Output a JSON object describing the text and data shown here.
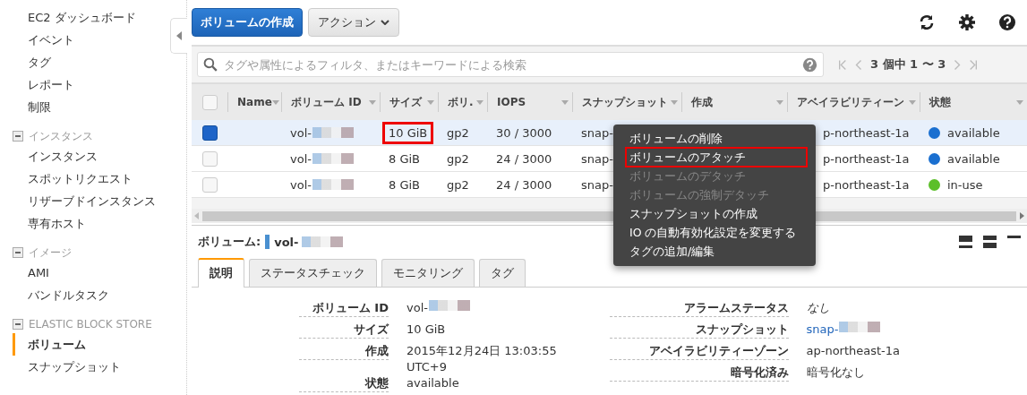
{
  "sidebar": {
    "items": [
      {
        "label": "EC2 ダッシュボード",
        "selected": false
      },
      {
        "label": "イベント",
        "selected": false
      },
      {
        "label": "タグ",
        "selected": false
      },
      {
        "label": "レポート",
        "selected": false
      },
      {
        "label": "制限",
        "selected": false
      }
    ],
    "sections": [
      {
        "title": "インスタンス",
        "expanded": true,
        "items": [
          {
            "label": "インスタンス",
            "selected": false
          },
          {
            "label": "スポットリクエスト",
            "selected": false
          },
          {
            "label": "リザーブドインスタンス",
            "selected": false
          },
          {
            "label": "専有ホスト",
            "selected": false
          }
        ]
      },
      {
        "title": "イメージ",
        "expanded": true,
        "items": [
          {
            "label": "AMI",
            "selected": false
          },
          {
            "label": "バンドルタスク",
            "selected": false
          }
        ]
      },
      {
        "title": "ELASTIC BLOCK STORE",
        "expanded": true,
        "items": [
          {
            "label": "ボリューム",
            "selected": true
          },
          {
            "label": "スナップショット",
            "selected": false
          }
        ]
      }
    ]
  },
  "toolbar": {
    "create_button": "ボリュームの作成",
    "actions_button": "アクション"
  },
  "search": {
    "placeholder": "タグや属性によるフィルタ、またはキーワードによる検索"
  },
  "pagination": {
    "label": "3 個中 1 〜 3"
  },
  "table": {
    "select_all": {
      "checked": false
    },
    "columns": [
      "Name",
      "ボリューム ID",
      "サイズ",
      "ボリ.",
      "IOPS",
      "スナップショット",
      "作成",
      "アベイラビリティーン",
      "状態"
    ],
    "rows": [
      {
        "selected": true,
        "volume_id": "vol-",
        "size": "10 GiB",
        "size_highlighted": true,
        "type": "gp2",
        "iops": "30 / 3000",
        "snapshot": "snap-",
        "zone": "p-northeast-1a",
        "state": "available",
        "color": "#1a6fd0"
      },
      {
        "selected": false,
        "volume_id": "vol-",
        "size": "8 GiB",
        "size_highlighted": false,
        "type": "gp2",
        "iops": "24 / 3000",
        "snapshot": "snap-",
        "zone": "p-northeast-1a",
        "state": "available",
        "color": "#1a6fd0"
      },
      {
        "selected": false,
        "volume_id": "vol-",
        "size": "8 GiB",
        "size_highlighted": false,
        "type": "gp2",
        "iops": "24 / 3000",
        "snapshot": "snap-",
        "zone": "p-northeast-1a",
        "state": "in-use",
        "color": "#5cbf2a"
      }
    ]
  },
  "context_menu": {
    "items": [
      {
        "label": "ボリュームの削除",
        "disabled": false,
        "highlighted": false
      },
      {
        "label": "ボリュームのアタッチ",
        "disabled": false,
        "highlighted": true
      },
      {
        "label": "ボリュームのデタッチ",
        "disabled": true,
        "highlighted": false
      },
      {
        "label": "ボリュームの強制デタッチ",
        "disabled": true,
        "highlighted": false
      },
      {
        "label": "スナップショットの作成",
        "disabled": false,
        "highlighted": false
      },
      {
        "label": "IO の自動有効化設定を変更する",
        "disabled": false,
        "highlighted": false
      },
      {
        "label": "タグの追加/編集",
        "disabled": false,
        "highlighted": false
      }
    ]
  },
  "detail": {
    "title_label": "ボリューム:",
    "title_value": "vol-",
    "tabs": [
      {
        "label": "説明",
        "selected": true
      },
      {
        "label": "ステータスチェック",
        "selected": false
      },
      {
        "label": "モニタリング",
        "selected": false
      },
      {
        "label": "タグ",
        "selected": false
      }
    ],
    "left_fields": [
      {
        "label": "ボリューム ID",
        "value": "vol-",
        "kind": "redacted"
      },
      {
        "label": "サイズ",
        "value": "10 GiB",
        "kind": "text"
      },
      {
        "label": "作成",
        "value": "2015年12月24日 13:03:55 UTC+9",
        "kind": "text"
      },
      {
        "label": "状態",
        "value": "available",
        "kind": "text"
      }
    ],
    "right_fields": [
      {
        "label": "アラームステータス",
        "value": "なし",
        "kind": "italic"
      },
      {
        "label": "スナップショット",
        "value": "snap-",
        "kind": "link"
      },
      {
        "label": "アベイラビリティーゾーン",
        "value": "ap-northeast-1a",
        "kind": "text"
      },
      {
        "label": "暗号化済み",
        "value": "暗号化なし",
        "kind": "text"
      }
    ]
  }
}
